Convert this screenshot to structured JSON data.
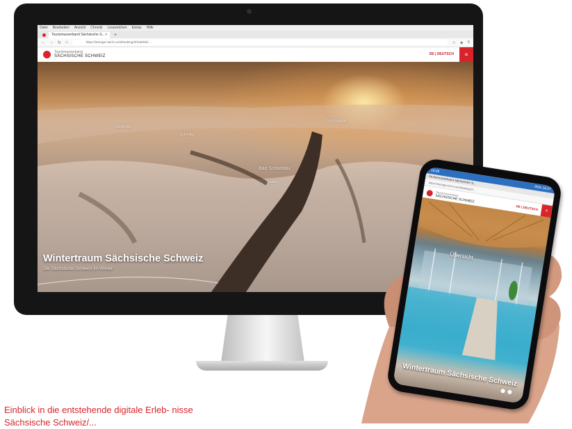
{
  "desktop_browser": {
    "menu": [
      "Datei",
      "Bearbeiten",
      "Ansicht",
      "Chronik",
      "Lesezeichen",
      "Extras",
      "Hilfe"
    ],
    "tab_title": "Tourismusverband Sächsische S...",
    "url": "https://storage.nwt-b.com/booking/3/1190/de/..."
  },
  "site": {
    "brand_top": "Tourismusverband",
    "brand_main": "SÄCHSISCHE SCHWEIZ",
    "language": "DE | DEUTSCH",
    "menu_icon": "hamburger-icon"
  },
  "panorama": {
    "places": [
      "Sebnitz",
      "Schmilka",
      "Bad Schandau",
      "Rathen"
    ],
    "title": "Wintertraum Sächsische Schweiz",
    "subtitle": "Die Sächsische Schweiz im Winter"
  },
  "phone": {
    "status_left": "16:45",
    "status_right": "90% 16:07",
    "tab_title": "Tourismusverband Sächsische S...",
    "url": "https://storage.nwt-b.com/booking/3/...",
    "brand_top": "Tourismusverband",
    "brand_main": "SÄCHSISCHE SCHWEIZ",
    "language": "DE | DEUTSCH",
    "place": "Übersicht",
    "title": "Wintertraum Sächsische Schweiz"
  },
  "caption": "Einblick in die entstehende digitale Erleb- nisse Sächsische Schweiz/..."
}
